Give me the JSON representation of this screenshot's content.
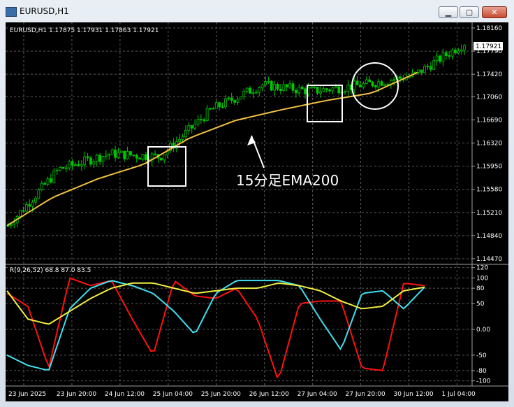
{
  "window": {
    "title": "EURUSD,H1",
    "minimize_label": "▁",
    "maximize_label": "▢",
    "close_label": "✕"
  },
  "chart_header": "EURUSD,H1  1.17875 1.17931 1.17863 1.17921",
  "price_axis": [
    "1.18160",
    "1.17790",
    "1.17420",
    "1.17060",
    "1.16690",
    "1.16320",
    "1.15950",
    "1.15580",
    "1.15210",
    "1.14840",
    "1.14470"
  ],
  "current_price": "1.17921",
  "indicator_header": "R(9,26,52) 68.8 87.0 83.5",
  "indicator_axis": [
    {
      "label": "120",
      "v": 120
    },
    {
      "label": "100",
      "v": 100
    },
    {
      "label": "80",
      "v": 80
    },
    {
      "label": "50",
      "v": 50
    },
    {
      "label": "0.00",
      "v": 0
    },
    {
      "label": "-50",
      "v": -50
    },
    {
      "label": "-80",
      "v": -80
    },
    {
      "label": "-100",
      "v": -100
    }
  ],
  "time_axis": [
    "23 Jun 2025",
    "23 Jun 20:00",
    "24 Jun 12:00",
    "25 Jun 04:00",
    "25 Jun 20:00",
    "26 Jun 12:00",
    "27 Jun 04:00",
    "27 Jun 20:00",
    "30 Jun 12:00",
    "1 Jul 04:00"
  ],
  "annotation_text": "15分足EMA200",
  "colors": {
    "candles": "#00c800",
    "ema": "#f0c040",
    "osc_red": "#ff1010",
    "osc_cyan": "#40e0f0",
    "osc_yellow": "#f0f040",
    "grid": "#5a5a5a",
    "annotation": "#ffffff"
  },
  "chart_data": [
    {
      "type": "line",
      "name": "price",
      "x": [
        "23 Jun 2025",
        "23 Jun 20:00",
        "24 Jun 12:00",
        "25 Jun 04:00",
        "25 Jun 20:00",
        "26 Jun 12:00",
        "27 Jun 04:00",
        "27 Jun 20:00",
        "30 Jun 12:00",
        "1 Jul 04:00"
      ],
      "series": [
        {
          "values": [
            1.15,
            1.159,
            1.1615,
            1.161,
            1.1685,
            1.1725,
            1.1715,
            1.1725,
            1.174,
            1.1792
          ]
        },
        {
          "values": [
            1.15,
            1.1545,
            1.1575,
            1.1598,
            1.164,
            1.1668,
            1.1685,
            1.17,
            1.1712,
            1.1745
          ]
        }
      ],
      "ylim": [
        1.1447,
        1.1816
      ]
    },
    {
      "type": "line",
      "name": "oscillator",
      "series": [
        {
          "values": [
            70,
            45,
            -75,
            100,
            85,
            95,
            20,
            -50,
            95,
            65,
            60,
            80,
            20,
            -100,
            50,
            55,
            55,
            -75,
            -80,
            90,
            85
          ]
        },
        {
          "values": [
            -50,
            -70,
            -80,
            40,
            80,
            95,
            85,
            70,
            35,
            -10,
            70,
            95,
            95,
            95,
            85,
            20,
            -40,
            70,
            75,
            40,
            82
          ]
        },
        {
          "values": [
            75,
            20,
            10,
            35,
            60,
            80,
            90,
            90,
            80,
            70,
            75,
            80,
            80,
            90,
            85,
            75,
            55,
            40,
            45,
            75,
            82
          ]
        }
      ],
      "ylim": [
        -110,
        125
      ]
    }
  ]
}
